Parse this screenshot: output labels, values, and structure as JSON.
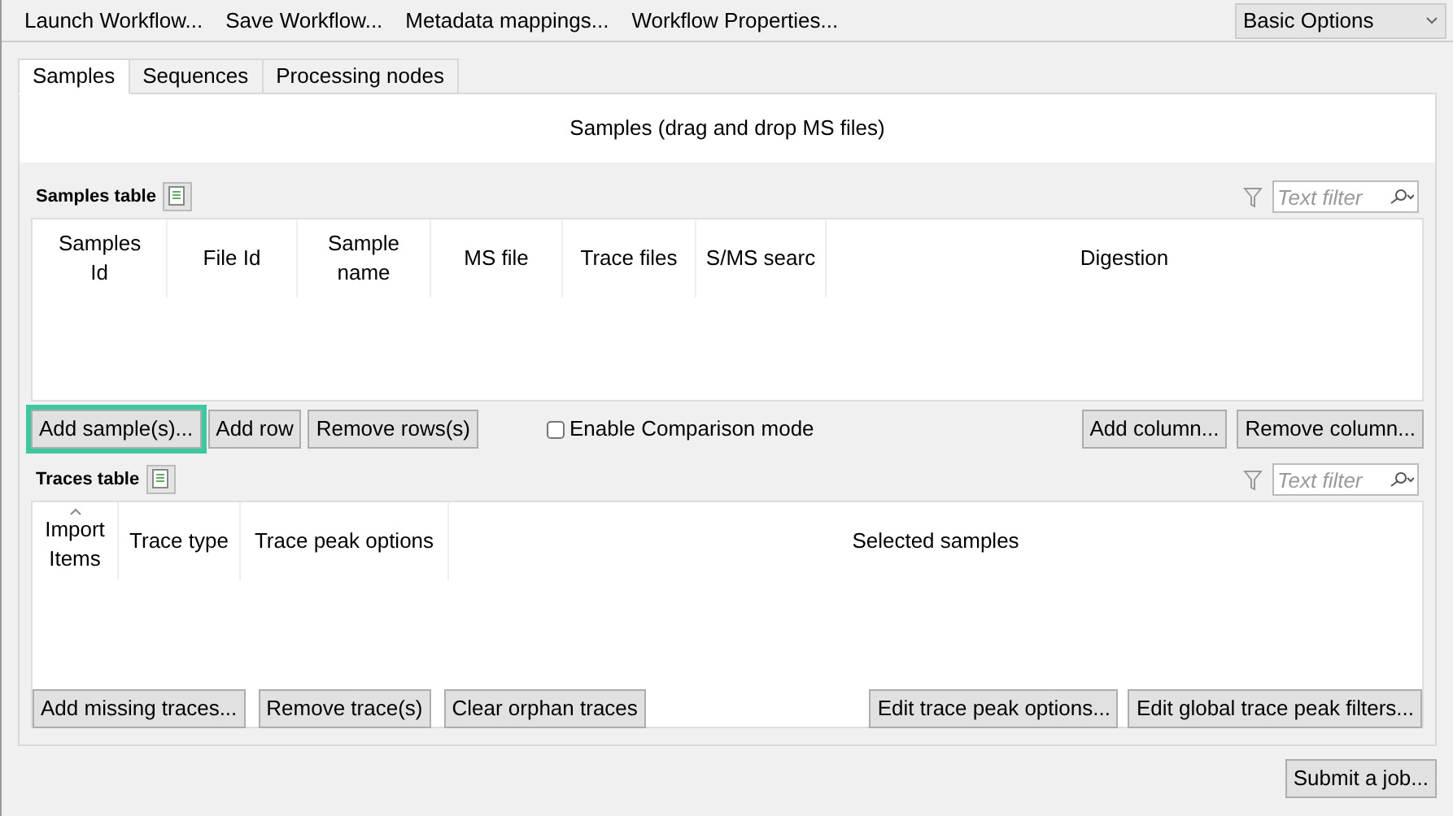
{
  "toolbar": {
    "items": [
      "Launch Workflow...",
      "Save Workflow...",
      "Metadata mappings...",
      "Workflow Properties..."
    ],
    "mode_select": {
      "value": "Basic Options"
    }
  },
  "tabs": [
    {
      "label": "Samples",
      "selected": true
    },
    {
      "label": "Sequences",
      "selected": false
    },
    {
      "label": "Processing nodes",
      "selected": false
    }
  ],
  "drop_banner": "Samples (drag and drop MS files)",
  "samples_table": {
    "title": "Samples table",
    "filter": {
      "placeholder": "Text filter"
    },
    "columns": [
      {
        "label": "Samples Id"
      },
      {
        "label": "File Id"
      },
      {
        "label": "Sample name"
      },
      {
        "label": "MS file"
      },
      {
        "label": "Trace files"
      },
      {
        "label": "S/MS searc"
      },
      {
        "label": "Digestion"
      }
    ],
    "left_buttons": [
      {
        "label": "Add sample(s)...",
        "focused": true
      },
      {
        "label": "Add row",
        "focused": false
      },
      {
        "label": "Remove rows(s)",
        "focused": false
      }
    ],
    "comparison": {
      "label": "Enable Comparison mode",
      "checked": false
    },
    "right_buttons": [
      "Add column...",
      "Remove column..."
    ]
  },
  "traces_table": {
    "title": "Traces table",
    "filter": {
      "placeholder": "Text filter"
    },
    "columns": [
      {
        "label": "Import Items",
        "sorted": true
      },
      {
        "label": "Trace type",
        "sorted": false
      },
      {
        "label": "Trace peak options",
        "sorted": false
      },
      {
        "label": "Selected samples",
        "sorted": false
      }
    ],
    "left_buttons": [
      "Add missing traces...",
      "Remove trace(s)",
      "Clear orphan traces"
    ],
    "right_buttons": [
      "Edit trace peak options...",
      "Edit global trace peak filters..."
    ]
  },
  "submit_button": "Submit a job..."
}
